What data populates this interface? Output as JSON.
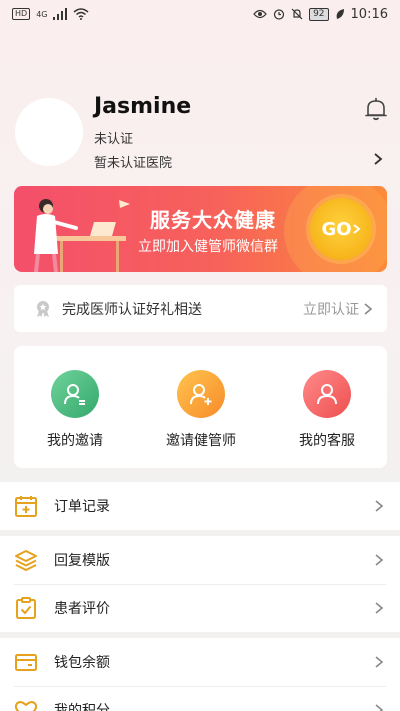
{
  "status_bar": {
    "network_badge": "HD",
    "network_type": "4G",
    "battery": "92",
    "time": "10:16"
  },
  "profile": {
    "name": "Jasmine",
    "auth_status": "未认证",
    "hospital": "暂未认证医院"
  },
  "banner": {
    "title": "服务大众健康",
    "subtitle": "立即加入健管师微信群",
    "go_label": "GO"
  },
  "certify": {
    "text": "完成医师认证好礼相送",
    "action": "立即认证"
  },
  "quick_actions": [
    {
      "label": "我的邀请",
      "color": "#3fb87a"
    },
    {
      "label": "邀请健管师",
      "color": "#f8a23a"
    },
    {
      "label": "我的客服",
      "color": "#f06262"
    }
  ],
  "menu": {
    "orders": "订单记录",
    "reply_templates": "回复模版",
    "patient_reviews": "患者评价",
    "wallet": "钱包余额",
    "points": "我的积分"
  },
  "colors": {
    "accent_icon": "#e6a21d",
    "banner_start": "#f44f6b",
    "banner_end": "#fb8b3a"
  }
}
